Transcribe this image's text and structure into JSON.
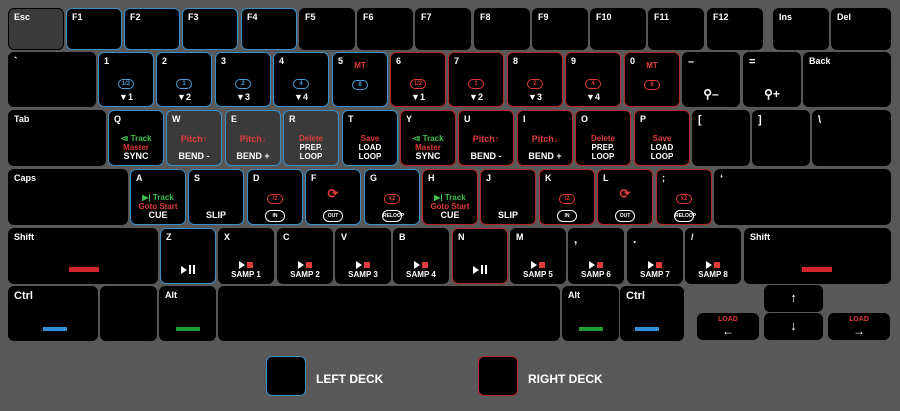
{
  "colors": {
    "left": "#3b8fc9",
    "right": "#b7242a",
    "blue_bar": "#2f8fd8",
    "green_bar": "#1f9f3a",
    "red_bar": "#d2242a"
  },
  "fn_row": [
    "Esc",
    "F1",
    "F2",
    "F3",
    "F4",
    "F5",
    "F6",
    "F7",
    "F8",
    "F9",
    "F10",
    "F11",
    "F12",
    "Ins",
    "Del"
  ],
  "num_row": {
    "backtick": "`",
    "keys": [
      {
        "key": "1",
        "icon": "1/2",
        "act": "▼1"
      },
      {
        "key": "2",
        "icon": "1",
        "act": "▼2"
      },
      {
        "key": "3",
        "icon": "2",
        "act": "▼3"
      },
      {
        "key": "4",
        "icon": "4",
        "act": "▼4"
      },
      {
        "key": "5",
        "top": "MT",
        "icon": "8",
        "act": ""
      },
      {
        "key": "6",
        "icon": "1/2",
        "act": "▼1"
      },
      {
        "key": "7",
        "icon": "1",
        "act": "▼2"
      },
      {
        "key": "8",
        "icon": "2",
        "act": "▼3"
      },
      {
        "key": "9",
        "icon": "4",
        "act": "▼4"
      },
      {
        "key": "0",
        "top": "MT",
        "icon": "8",
        "act": ""
      }
    ],
    "minus": "–",
    "equals": "=",
    "zoom_out": "–",
    "zoom_in": "+",
    "back": "Back"
  },
  "q_row": {
    "tab": "Tab",
    "keys": [
      {
        "key": "Q",
        "l1": "⧏ Track",
        "l2": "Master",
        "l3": "SYNC"
      },
      {
        "key": "W",
        "l1": "Pitch↑",
        "l3": "BEND -"
      },
      {
        "key": "E",
        "l1": "Pitch↓",
        "l3": "BEND +"
      },
      {
        "key": "R",
        "l1": "Delete",
        "l2": "PREP.",
        "l3": "LOOP"
      },
      {
        "key": "T",
        "l1": "Save",
        "l2": "LOAD",
        "l3": "LOOP"
      },
      {
        "key": "Y",
        "l1": "⧏ Track",
        "l2": "Master",
        "l3": "SYNC"
      },
      {
        "key": "U",
        "l1": "Pitch↑",
        "l3": "BEND -"
      },
      {
        "key": "I",
        "l1": "Pitch↓",
        "l3": "BEND +"
      },
      {
        "key": "O",
        "l1": "Delete",
        "l2": "PREP.",
        "l3": "LOOP"
      },
      {
        "key": "P",
        "l1": "Save",
        "l2": "LOAD",
        "l3": "LOOP"
      }
    ],
    "lbracket": "[",
    "rbracket": "]",
    "backslash": "\\"
  },
  "a_row": {
    "caps": "Caps",
    "keys": [
      {
        "key": "A",
        "l1": "▶| Track",
        "l2": "Goto Start",
        "l3": "CUE"
      },
      {
        "key": "S",
        "l3": "SLIP"
      },
      {
        "key": "D",
        "icon": "/2",
        "icon2": "IN"
      },
      {
        "key": "F",
        "icon2": "OUT"
      },
      {
        "key": "G",
        "icon": "x2",
        "icon2": "RELOOP"
      },
      {
        "key": "H",
        "l1": "▶| Track",
        "l2": "Goto Start",
        "l3": "CUE"
      },
      {
        "key": "J",
        "l3": "SLIP"
      },
      {
        "key": "K",
        "icon": "/2",
        "icon2": "IN"
      },
      {
        "key": "L",
        "icon2": "OUT"
      },
      {
        "key": ";",
        "icon": "x2",
        "icon2": "RELOOP"
      }
    ],
    "quote": "‘"
  },
  "z_row": {
    "shift_l": "Shift",
    "keys": [
      {
        "key": "Z",
        "act": "playpause"
      },
      {
        "key": "X",
        "act": "SAMP 1"
      },
      {
        "key": "C",
        "act": "SAMP 2"
      },
      {
        "key": "V",
        "act": "SAMP 3"
      },
      {
        "key": "B",
        "act": "SAMP 4"
      },
      {
        "key": "N",
        "act": "playpause"
      },
      {
        "key": "M",
        "act": "SAMP 5"
      },
      {
        "key": ",",
        "act": "SAMP 6"
      },
      {
        "key": ".",
        "act": "SAMP 7"
      },
      {
        "key": "/",
        "act": "SAMP 8"
      }
    ],
    "shift_r": "Shift"
  },
  "bottom_row": {
    "ctrl_l": "Ctrl",
    "alt_l": "Alt",
    "alt_r": "Alt",
    "ctrl_r": "Ctrl",
    "load": "LOAD",
    "arrow_up": "↑",
    "arrow_down": "↓",
    "arrow_left": "←",
    "arrow_right": "→"
  },
  "legend": {
    "left": "LEFT DECK",
    "right": "RIGHT DECK"
  }
}
